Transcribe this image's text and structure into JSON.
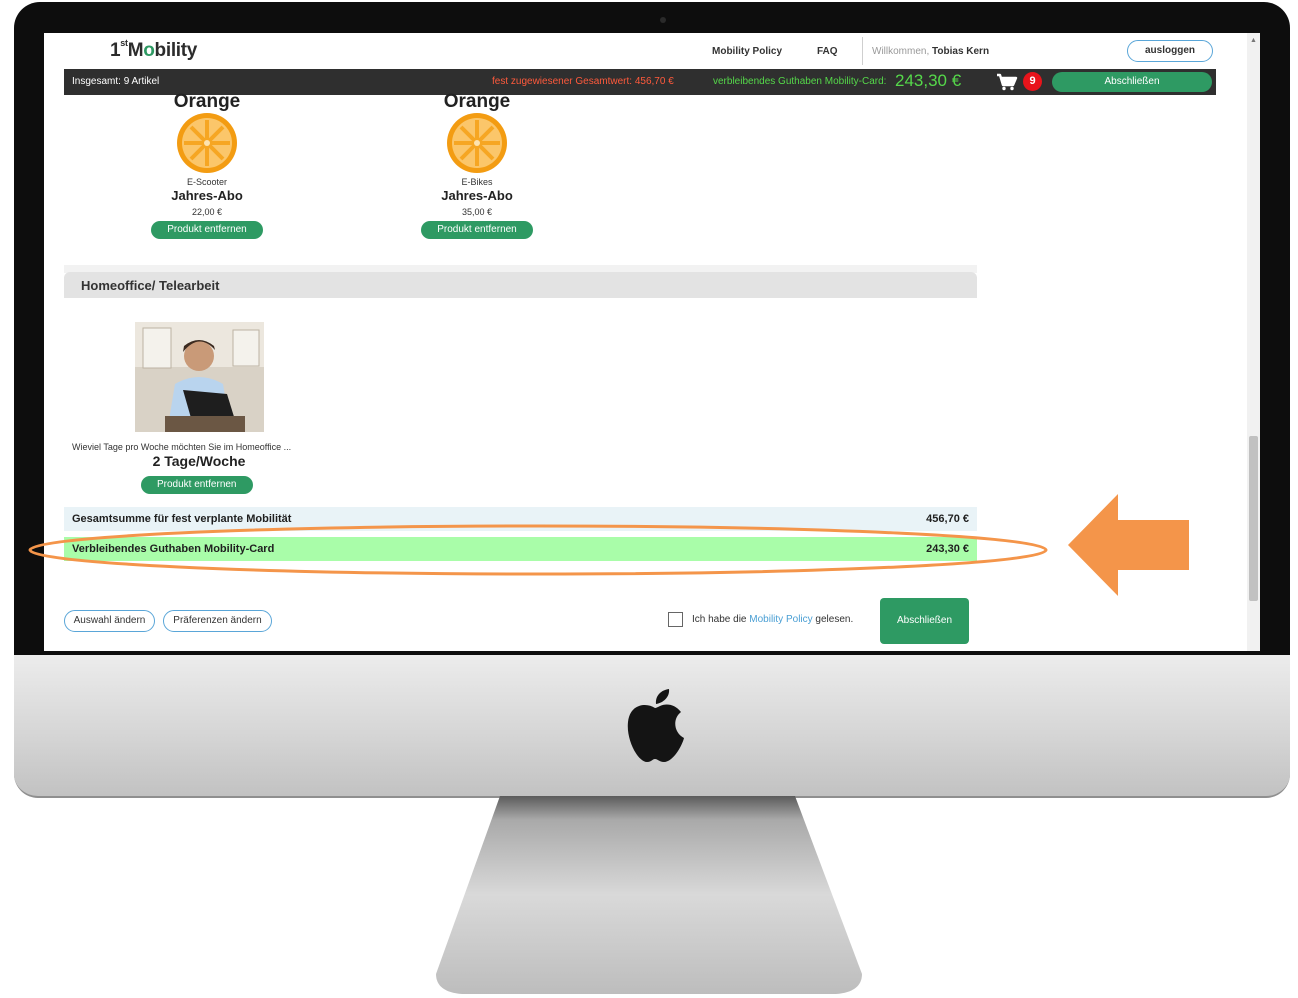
{
  "header": {
    "logo_main": "1",
    "logo_sup": "st",
    "logo_m": "M",
    "logo_o": "o",
    "logo_rest": "bility",
    "nav_policy": "Mobility Policy",
    "nav_faq": "FAQ",
    "welcome_prefix": "Willkommen,",
    "user_name": "Tobias Kern",
    "logout_label": "ausloggen"
  },
  "summary_bar": {
    "total_items": "Insgesamt:  9 Artikel",
    "fixed_value_label": "fest zugewiesener Gesamtwert:  456,70 €",
    "credit_label": "verbleibendes Guthaben Mobility-Card:",
    "credit_value": "243,30 €",
    "cart_count": "9",
    "finish_label": "Abschließen"
  },
  "products": [
    {
      "name": "Orange",
      "category": "E-Scooter",
      "title": "Jahres-Abo",
      "price": "22,00 €",
      "remove_label": "Produkt entfernen"
    },
    {
      "name": "Orange",
      "category": "E-Bikes",
      "title": "Jahres-Abo",
      "price": "35,00 €",
      "remove_label": "Produkt entfernen"
    }
  ],
  "homeoffice": {
    "section_title": "Homeoffice/ Telearbeit",
    "question": "Wieviel Tage pro Woche möchten Sie im Homeoffice ...",
    "answer": "2 Tage/Woche",
    "remove_label": "Produkt entfernen"
  },
  "totals": {
    "fixed_label": "Gesamtsumme für fest verplante Mobilität",
    "fixed_value": "456,70 €",
    "credit_label": "Verbleibendes Guthaben Mobility-Card",
    "credit_value": "243,30 €"
  },
  "footer": {
    "change_selection": "Auswahl ändern",
    "change_preferences": "Präferenzen ändern",
    "policy_prefix": "Ich habe die",
    "policy_link": "Mobility Policy",
    "policy_suffix": "gelesen.",
    "finish_label": "Abschließen",
    "policy_checked": false
  },
  "colors": {
    "brand_green": "#2e9a63",
    "credit_green": "#55d84a",
    "highlight_green": "#a9fda9",
    "fixed_red": "#ff5a3c",
    "badge_red": "#e8141b",
    "annotation_orange": "#f4954a"
  },
  "icons": {
    "cart": "cart-icon",
    "orange": "orange-icon",
    "apple": "apple-logo",
    "arrow": "arrow-left-icon"
  }
}
